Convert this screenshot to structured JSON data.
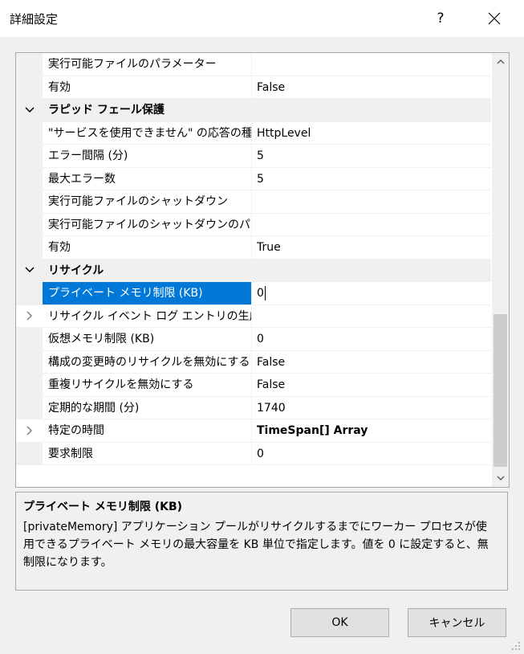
{
  "window": {
    "title": "詳細設定",
    "help": "?"
  },
  "rows_top": [
    {
      "name": "実行可能ファイルのパラメーター",
      "value": ""
    },
    {
      "name": "有効",
      "value": "False"
    }
  ],
  "cat1": {
    "label": "ラピッド フェール保護"
  },
  "rows_cat1": [
    {
      "name": "\"サービスを使用できません\" の応答の種類",
      "value": "HttpLevel"
    },
    {
      "name": "エラー間隔 (分)",
      "value": "5"
    },
    {
      "name": "最大エラー数",
      "value": "5"
    },
    {
      "name": "実行可能ファイルのシャットダウン",
      "value": ""
    },
    {
      "name": "実行可能ファイルのシャットダウンのパラメーター",
      "value": ""
    },
    {
      "name": "有効",
      "value": "True"
    }
  ],
  "cat2": {
    "label": "リサイクル"
  },
  "rows_cat2": [
    {
      "name": "プライベート メモリ制限 (KB)",
      "value": "0"
    },
    {
      "name": "リサイクル イベント ログ エントリの生成",
      "value": ""
    },
    {
      "name": "仮想メモリ制限 (KB)",
      "value": "0"
    },
    {
      "name": "構成の変更時のリサイクルを無効にする",
      "value": "False"
    },
    {
      "name": "重複リサイクルを無効にする",
      "value": "False"
    },
    {
      "name": "定期的な期間 (分)",
      "value": "1740"
    },
    {
      "name": "特定の時間",
      "value": "TimeSpan[] Array"
    },
    {
      "name": "要求制限",
      "value": "0"
    }
  ],
  "description": {
    "title": "プライベート メモリ制限 (KB)",
    "body": "[privateMemory] アプリケーション プールがリサイクルするまでにワーカー プロセスが使用できるプライベート メモリの最大容量を KB 単位で指定します。値を 0 に設定すると、無制限になります。"
  },
  "buttons": {
    "ok": "OK",
    "cancel": "キャンセル"
  }
}
